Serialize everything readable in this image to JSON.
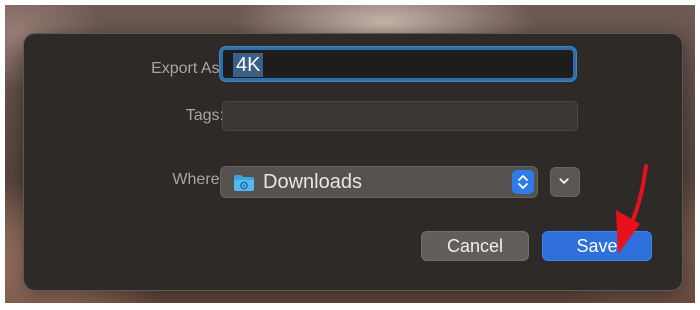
{
  "dialog": {
    "export_label": "Export As:",
    "export_value": "4K",
    "tags_label": "Tags:",
    "tags_value": "",
    "where_label": "Where:",
    "where_value": "Downloads",
    "folder_icon": "folder-icon",
    "stepper_icon": "chevron-updown-icon",
    "expand_icon": "chevron-down-icon",
    "cancel_label": "Cancel",
    "save_label": "Save"
  },
  "annotation": {
    "arrow_color": "#e8101a",
    "points_to": "save-button"
  },
  "colors": {
    "accent": "#2e6fdb",
    "dialog_bg": "#2e2a27"
  }
}
